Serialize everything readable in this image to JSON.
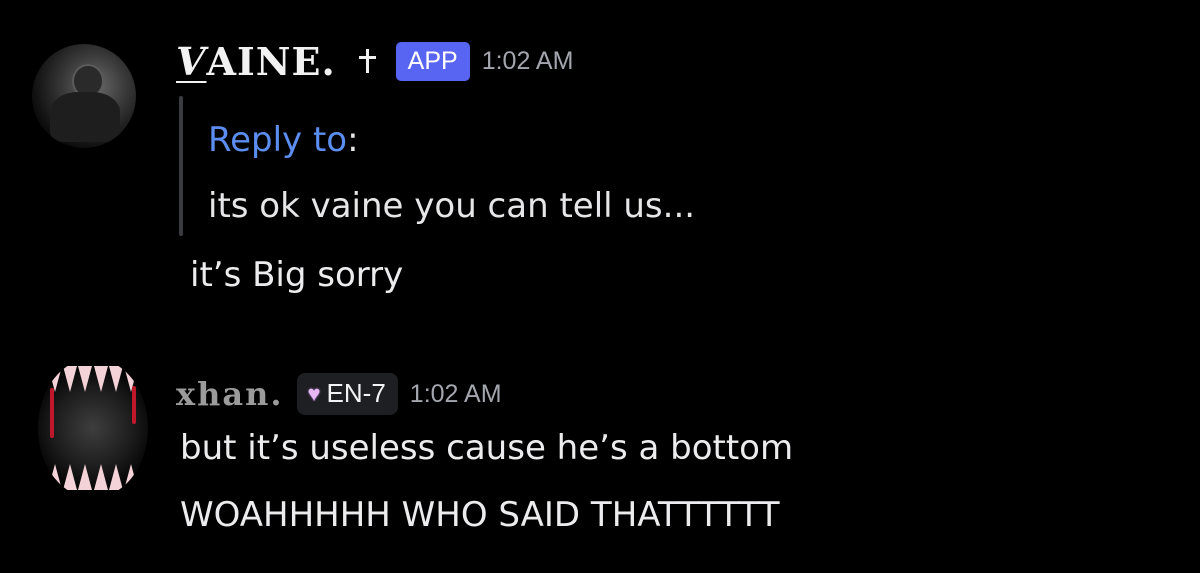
{
  "messages": [
    {
      "username_prefix": "V",
      "username_rest": "AINE.",
      "badge": "APP",
      "timestamp": "1:02 AM",
      "reply": {
        "link_label": "Reply to",
        "colon": ":",
        "quoted_text": "its ok vaine you can tell us..."
      },
      "text": "it’s Big sorry"
    },
    {
      "username": "xhan.",
      "role_tag": "EN-7",
      "role_icon": "heart-icon",
      "timestamp": "1:02 AM",
      "lines": [
        "but it’s useless cause he’s a bottom",
        "WOAHHHHH WHO SAID THATTTTTT"
      ]
    }
  ],
  "colors": {
    "background": "#000000",
    "app_badge": "#5865f2",
    "reply_link": "#5b8ef0",
    "timestamp": "#a3a6ad",
    "role_tag_bg": "#1e1f22"
  }
}
